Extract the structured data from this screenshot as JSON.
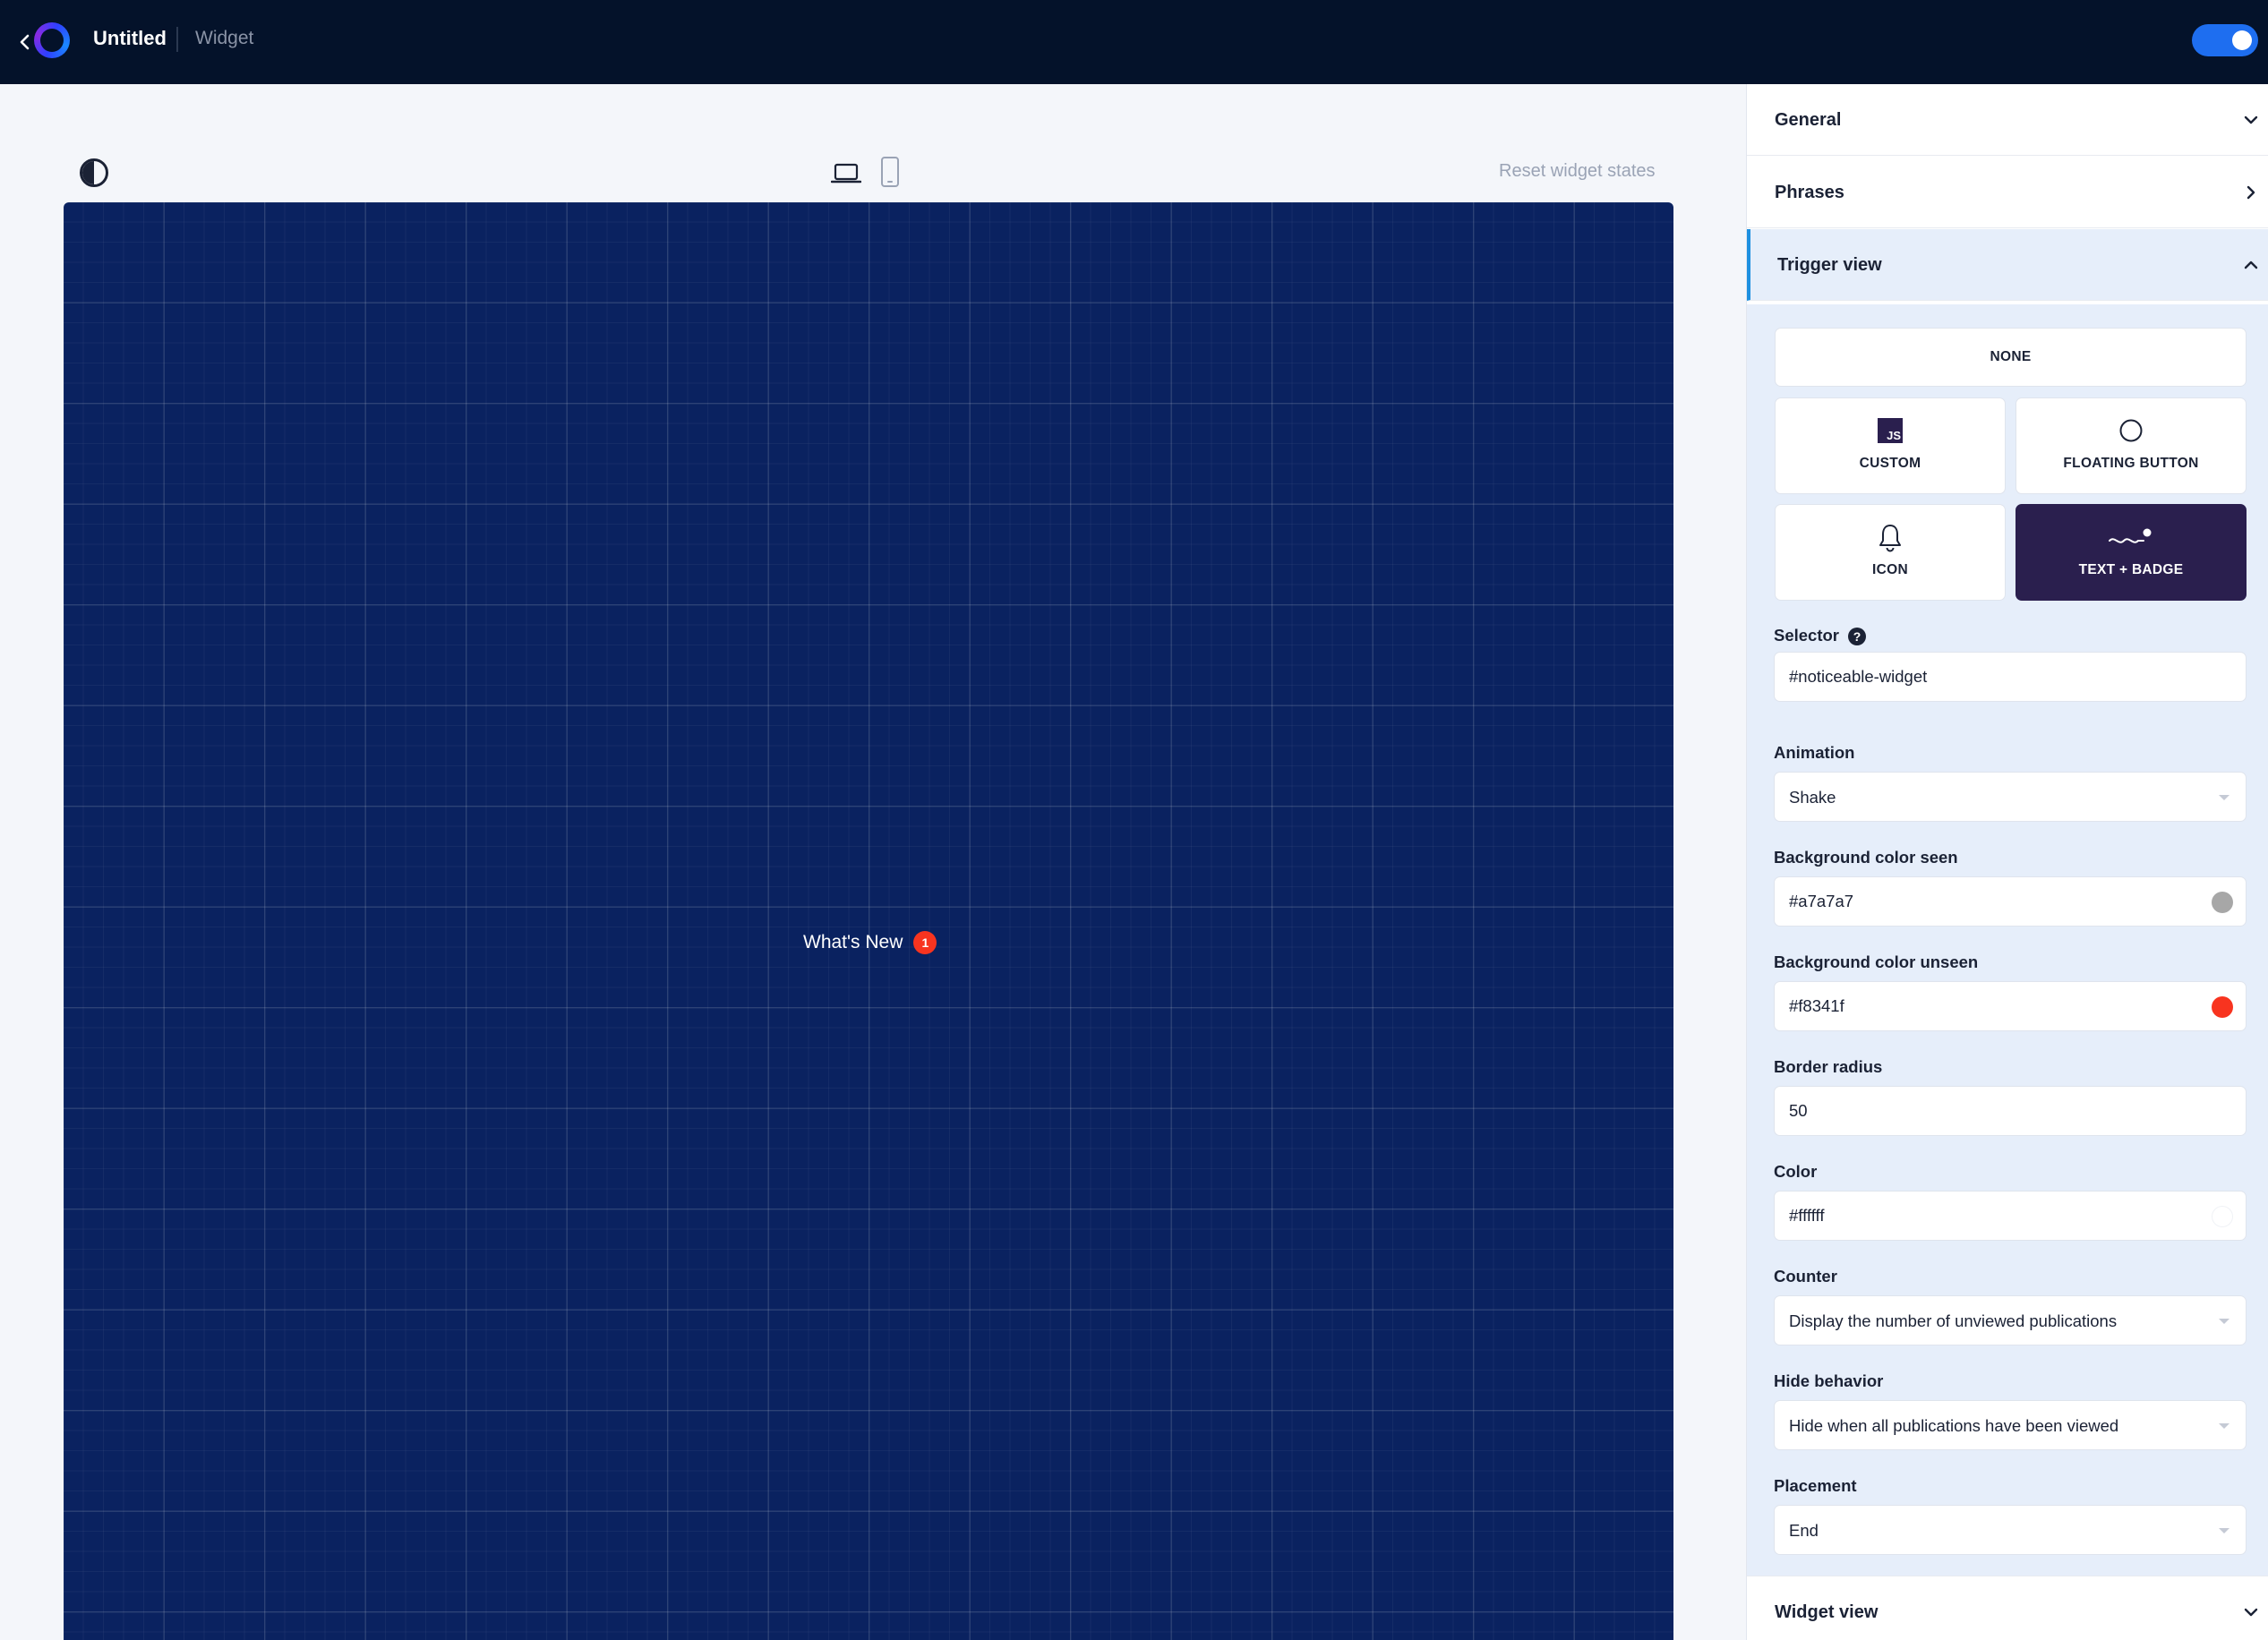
{
  "topbar": {
    "title": "Untitled",
    "subtitle": "Widget",
    "toggle_on": true
  },
  "preview": {
    "reset_label": "Reset widget states",
    "trigger_text": "What's New",
    "badge_count": "1",
    "canvas_color": "#0a2260"
  },
  "panel": {
    "sections": {
      "general": "General",
      "phrases": "Phrases",
      "trigger_view": "Trigger view",
      "widget_view": "Widget view"
    },
    "trigger_options": {
      "none": "NONE",
      "custom": "CUSTOM",
      "custom_icon": "JS",
      "floating": "FLOATING BUTTON",
      "icon": "ICON",
      "text_badge": "TEXT + BADGE",
      "selected": "TEXT + BADGE"
    },
    "fields": {
      "selector_label": "Selector",
      "selector_value": "#noticeable-widget",
      "animation_label": "Animation",
      "animation_value": "Shake",
      "bg_seen_label": "Background color seen",
      "bg_seen_value": "#a7a7a7",
      "bg_unseen_label": "Background color unseen",
      "bg_unseen_value": "#f8341f",
      "border_radius_label": "Border radius",
      "border_radius_value": "50",
      "color_label": "Color",
      "color_value": "#ffffff",
      "counter_label": "Counter",
      "counter_value": "Display the number of unviewed publications",
      "hide_label": "Hide behavior",
      "hide_value": "Hide when all publications have been viewed",
      "placement_label": "Placement",
      "placement_value": "End"
    }
  },
  "colors": {
    "topbar_bg": "#04122a",
    "accent": "#1e6ef0",
    "selected_option": "#2a1f4e",
    "panel_section_bg": "#e6eefa"
  }
}
